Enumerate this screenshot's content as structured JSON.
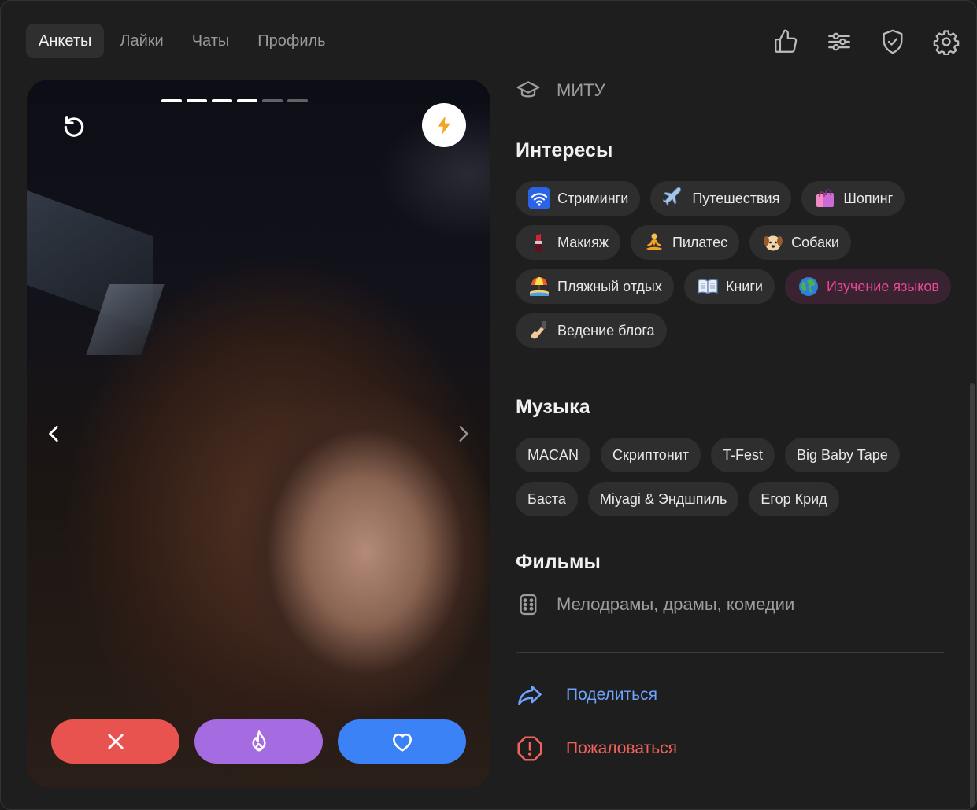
{
  "nav": {
    "tabs": [
      {
        "label": "Анкеты",
        "active": true
      },
      {
        "label": "Лайки"
      },
      {
        "label": "Чаты"
      },
      {
        "label": "Профиль"
      }
    ],
    "icons": [
      "thumbs-up-icon",
      "sliders-icon",
      "shield-check-icon",
      "gear-icon"
    ]
  },
  "card": {
    "photo_count": 6,
    "current_photo": 4,
    "undo_icon": "undo-icon",
    "boost_icon": "lightning-icon",
    "actions": [
      "close-icon",
      "flame-icon",
      "heart-icon"
    ]
  },
  "profile": {
    "education": "МИТУ",
    "interests_title": "Интересы",
    "interests": [
      {
        "label": "Стриминги",
        "icon": "wifi-icon"
      },
      {
        "label": "Путешествия",
        "icon": "airplane-icon"
      },
      {
        "label": "Шопинг",
        "icon": "shopping-bags-icon"
      },
      {
        "label": "Макияж",
        "icon": "lipstick-icon"
      },
      {
        "label": "Пилатес",
        "icon": "meditation-icon"
      },
      {
        "label": "Собаки",
        "icon": "dog-icon"
      },
      {
        "label": "Пляжный отдых",
        "icon": "beach-icon"
      },
      {
        "label": "Книги",
        "icon": "book-icon"
      },
      {
        "label": "Изучение языков",
        "icon": "globe-icon",
        "highlight": true
      },
      {
        "label": "Ведение блога",
        "icon": "selfie-icon"
      }
    ],
    "music_title": "Музыка",
    "music": [
      "MACAN",
      "Скриптонит",
      "T-Fest",
      "Big Baby Tape",
      "Баста",
      "Miyagi & Эндшпиль",
      "Егор Крид"
    ],
    "movies_title": "Фильмы",
    "movies": "Мелодрамы, драмы, комедии",
    "share_label": "Поделиться",
    "report_label": "Пожаловаться"
  },
  "colors": {
    "dislike": "#e8534f",
    "superlike": "#a56be0",
    "like": "#3b82f6",
    "share": "#6ea3ff",
    "report": "#f0625d",
    "highlight_chip": "#ec4899"
  }
}
